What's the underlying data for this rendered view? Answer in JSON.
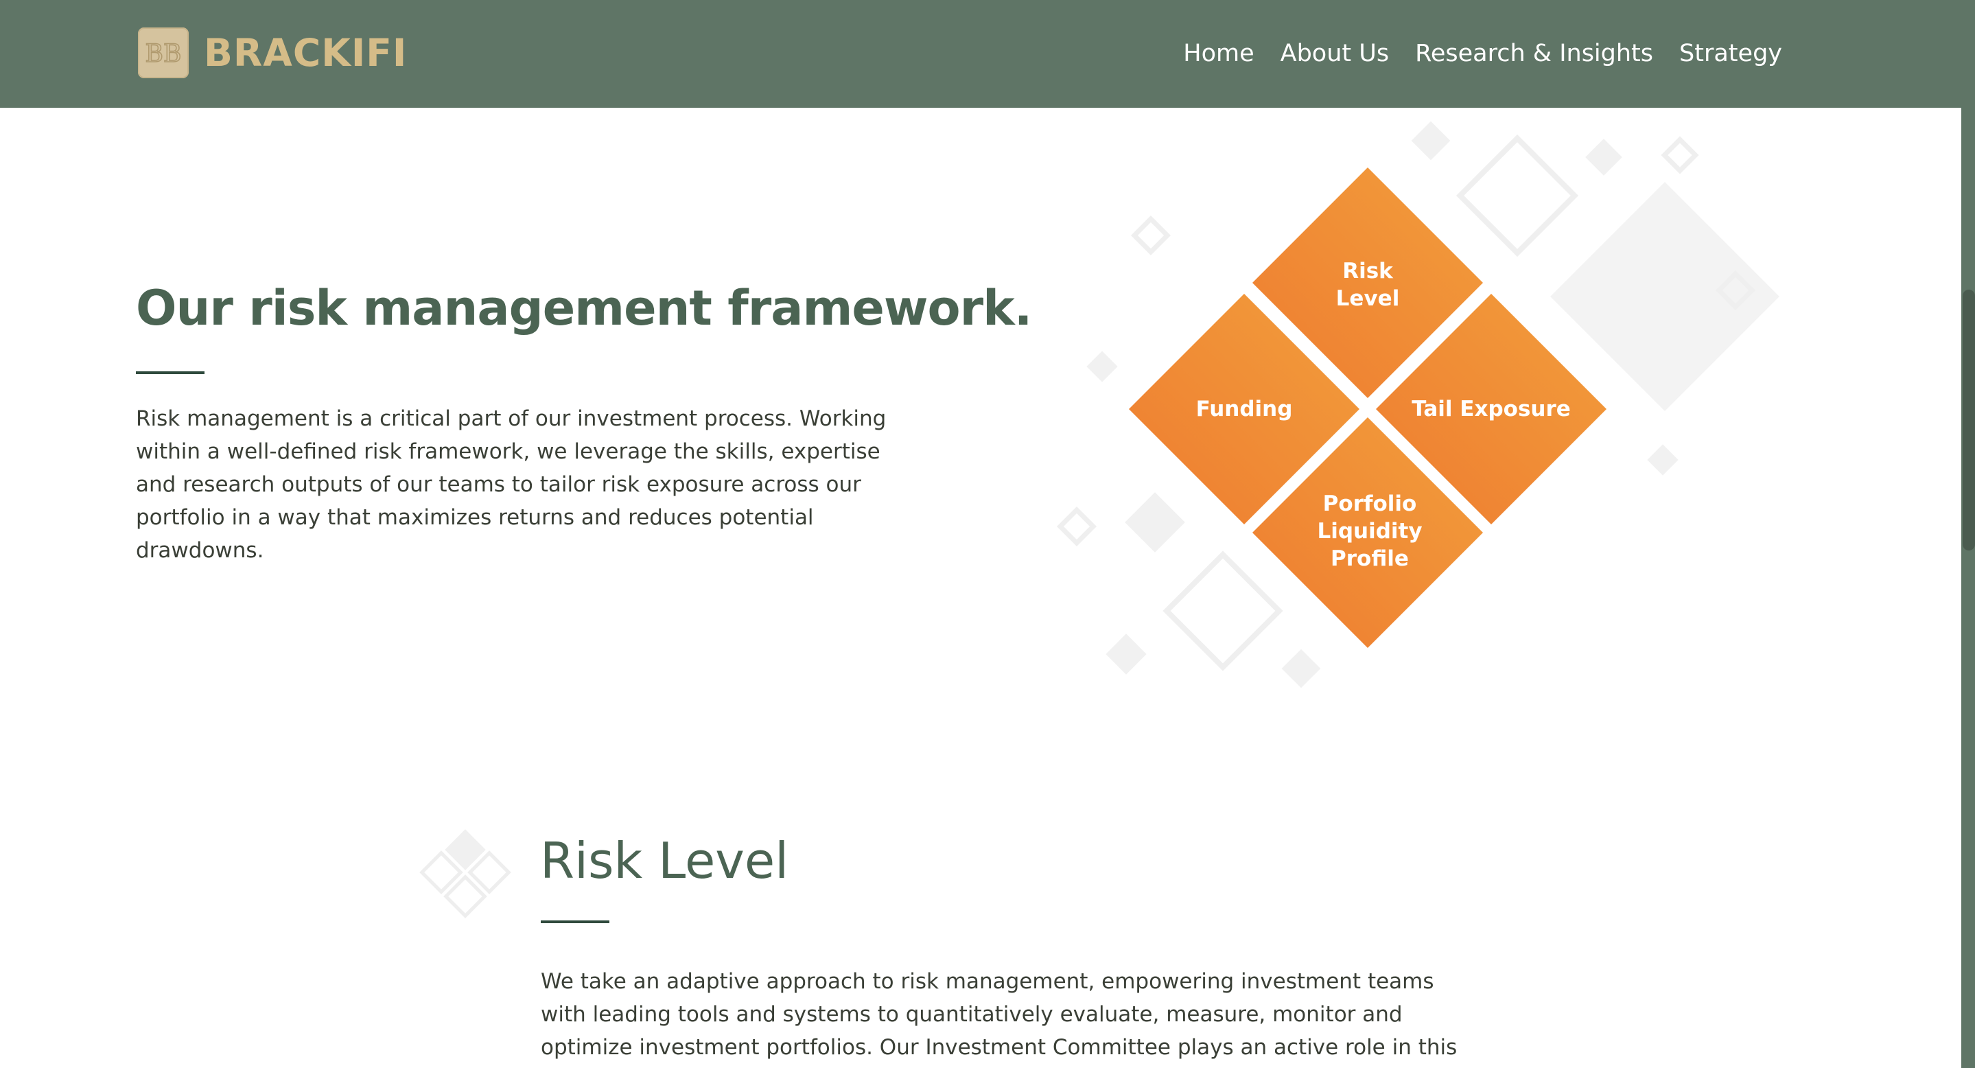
{
  "header": {
    "brand": "BRACKIFI",
    "logo_monogram": "BB",
    "colors": {
      "nav_background": "#5f7566",
      "brand_text": "#d5bc88",
      "logo_mark": "#d5c39e"
    },
    "nav": [
      {
        "label": "Home"
      },
      {
        "label": "About Us"
      },
      {
        "label": "Research & Insights"
      },
      {
        "label": "Strategy"
      }
    ]
  },
  "intro": {
    "title": "Our risk management framework.",
    "body": "Risk management is a critical part of our investment process. Working within a well-defined risk framework, we leverage the skills, expertise and research outputs of our teams to tailor risk exposure across our portfolio in a way that maximizes returns and reduces potential drawdowns."
  },
  "framework_diagram": {
    "tile_color_start": "#f29e3c",
    "tile_color_end": "#ee7c30",
    "tiles": [
      {
        "lines": [
          "Risk",
          "Level"
        ]
      },
      {
        "lines": [
          "Funding"
        ]
      },
      {
        "lines": [
          "Tail Exposure"
        ]
      },
      {
        "lines": [
          "Porfolio",
          "Liquidity",
          "Profile"
        ]
      }
    ]
  },
  "risk_level": {
    "icon": "diamond-cluster-icon",
    "title": "Risk Level",
    "body": "We take an adaptive approach to risk management, empowering investment teams with leading tools and systems to quantitatively evaluate, measure, monitor and optimize investment portfolios. Our Investment Committee plays an active role in this ongoing and"
  }
}
